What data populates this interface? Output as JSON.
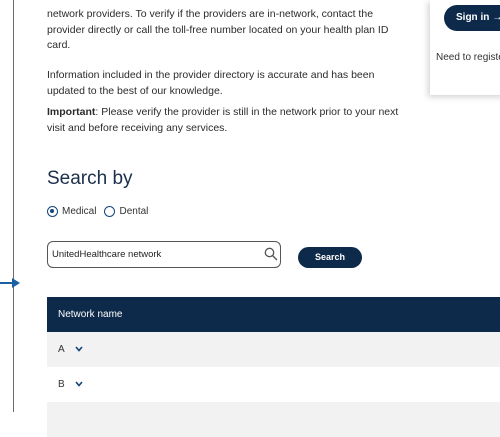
{
  "paragraphs": {
    "p1": "network providers. To verify if the providers are in-network, contact the provider directly or call the toll-free number located on your health plan ID card.",
    "p2": "Information included in the provider directory is accurate and has been updated to the best of our knowledge.",
    "p3_bold": "Important",
    "p3_rest": ": Please verify the provider is still in the network prior to your next visit and before receiving any services."
  },
  "card": {
    "signin_label": "Sign in",
    "signin_arrow": "→",
    "note": "Need to register?"
  },
  "search": {
    "heading": "Search by",
    "options": [
      {
        "label": "Medical",
        "selected": true
      },
      {
        "label": "Dental",
        "selected": false
      }
    ],
    "input_value": "UnitedHealthcare network",
    "button_label": "Search"
  },
  "table": {
    "header": "Network name",
    "rows": [
      {
        "letter": "A"
      },
      {
        "letter": "B"
      },
      {
        "letter": ""
      }
    ]
  },
  "colors": {
    "navy": "#0e2a4a",
    "accent": "#12457a",
    "row_shade": "#f2f2f2"
  }
}
